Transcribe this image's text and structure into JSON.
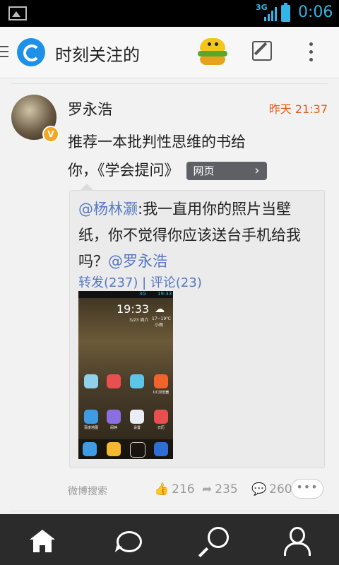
{
  "status_bar": {
    "network": "3G",
    "time": "0:06"
  },
  "header": {
    "title": "时刻关注的"
  },
  "post": {
    "author": "罗永浩",
    "time": "昨天 21:37",
    "text_line1": "推荐一本批判性思维的书给",
    "text_line2": "你，《学会提问》",
    "link_tag": "网页",
    "retweet": {
      "mention": "@杨林灏",
      "text": ":我一直用你的照片当壁纸，你不觉得你应该送台手机给我吗？",
      "mention2": "@罗永浩",
      "stats": "转发(237) | 评论(23)",
      "image": {
        "network": "3G",
        "status_time": "19:33",
        "clock": "19:33",
        "date": "3/23 周六",
        "weather_temp": "17~19℃",
        "weather_place": "小雨",
        "apps_row1": [
          "",
          "",
          "",
          "UC浏览器"
        ],
        "apps_row2": [
          "百度地图",
          "闹钟",
          "设置",
          "日历"
        ]
      }
    },
    "source": "微博搜索",
    "likes": "216",
    "reposts": "235",
    "comments": "260",
    "more": "•••"
  },
  "icons": {
    "header": [
      "menu-icon",
      "weibo-logo-icon",
      "sticker-icon",
      "compose-icon",
      "more-icon"
    ],
    "nav": [
      "home-icon",
      "message-icon",
      "search-icon",
      "profile-icon"
    ],
    "footer": [
      "like-icon",
      "repost-icon",
      "comment-icon"
    ]
  },
  "colors": {
    "accent": "#e8581c",
    "link": "#5478c2",
    "status": "#33b5e5",
    "nav_bg": "#2b2b2b"
  }
}
